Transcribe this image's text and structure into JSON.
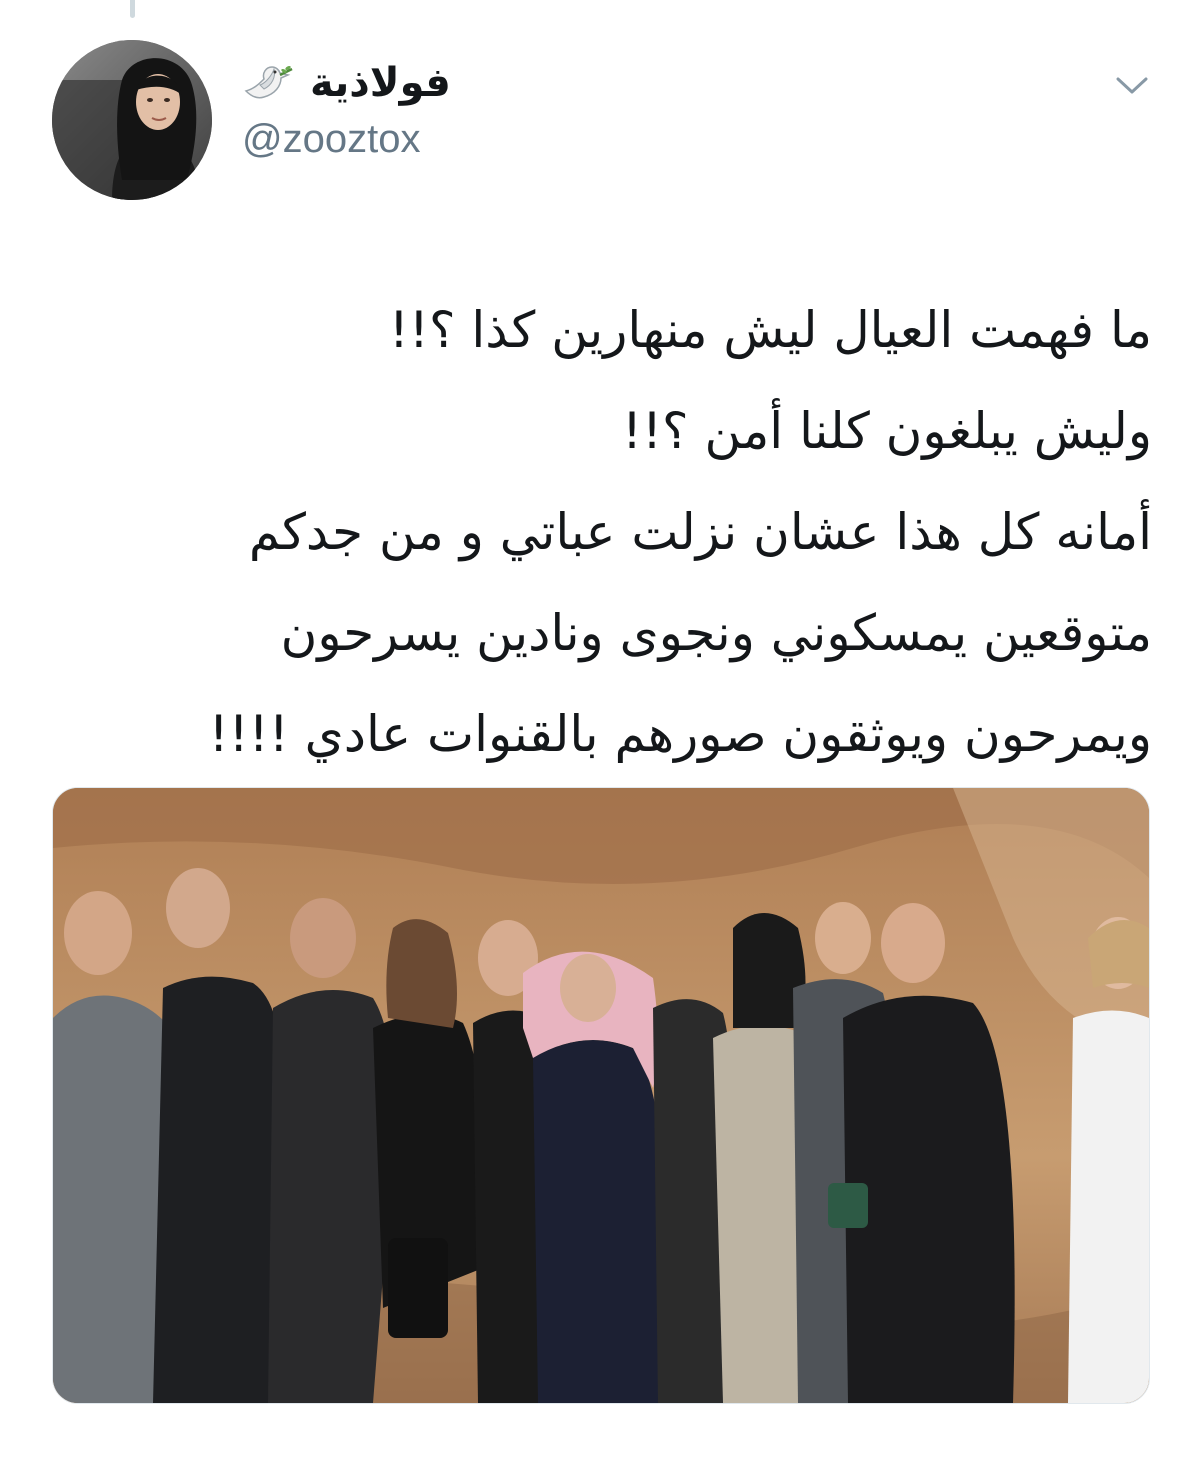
{
  "tweet": {
    "display_name": "فولاذية",
    "display_name_emoji": "dove-icon",
    "handle": "@zooztox",
    "more_icon": "chevron-down-icon",
    "text_lines": [
      "ما فهمت العيال ليش منهارين كذا ؟!!",
      "وليش يبلغون كلنا أمن ؟!!",
      "أمانه كل هذا عشان نزلت عباتي و من جدكم",
      "متوقعين يمسكوني ونجوى ونادين يسرحون",
      "ويمرحون ويوثقون صورهم بالقنوات عادي !!!!"
    ],
    "media": {
      "type": "photo",
      "description_icon": "group-photo"
    }
  },
  "colors": {
    "text": "#14171a",
    "secondary_text": "#657786",
    "thread_line": "#cfd9de",
    "background": "#ffffff"
  }
}
